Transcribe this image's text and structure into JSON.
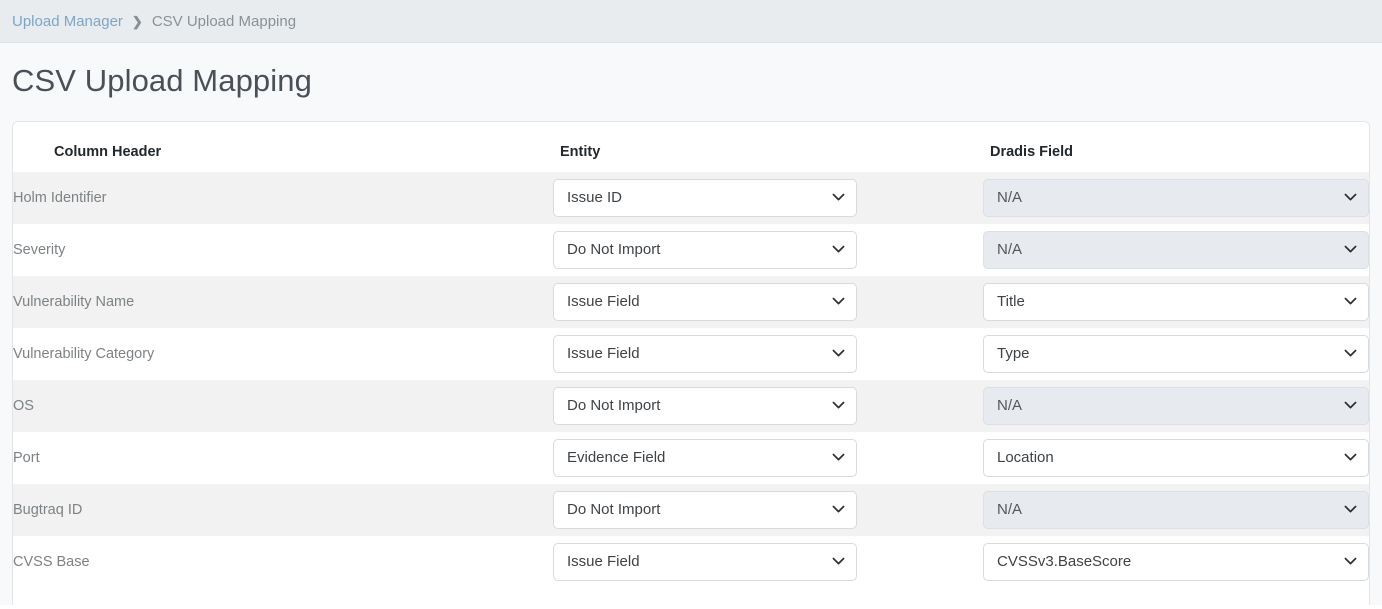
{
  "breadcrumb": {
    "parent_label": "Upload Manager",
    "separator": "›",
    "current_label": "CSV Upload Mapping"
  },
  "page": {
    "title": "CSV Upload Mapping"
  },
  "table": {
    "columns": {
      "column_header": "Column Header",
      "entity": "Entity",
      "dradis_field": "Dradis Field"
    },
    "rows": [
      {
        "column_header": "Holm Identifier",
        "entity": "Issue ID",
        "entity_disabled": false,
        "dradis_field": "N/A",
        "dradis_disabled": true
      },
      {
        "column_header": "Severity",
        "entity": "Do Not Import",
        "entity_disabled": false,
        "dradis_field": "N/A",
        "dradis_disabled": true
      },
      {
        "column_header": "Vulnerability Name",
        "entity": "Issue Field",
        "entity_disabled": false,
        "dradis_field": "Title",
        "dradis_disabled": false
      },
      {
        "column_header": "Vulnerability Category",
        "entity": "Issue Field",
        "entity_disabled": false,
        "dradis_field": "Type",
        "dradis_disabled": false
      },
      {
        "column_header": "OS",
        "entity": "Do Not Import",
        "entity_disabled": false,
        "dradis_field": "N/A",
        "dradis_disabled": true
      },
      {
        "column_header": "Port",
        "entity": "Evidence Field",
        "entity_disabled": false,
        "dradis_field": "Location",
        "dradis_disabled": false
      },
      {
        "column_header": "Bugtraq ID",
        "entity": "Do Not Import",
        "entity_disabled": false,
        "dradis_field": "N/A",
        "dradis_disabled": true
      },
      {
        "column_header": "CVSS Base",
        "entity": "Issue Field",
        "entity_disabled": false,
        "dradis_field": "CVSSv3.BaseScore",
        "dradis_disabled": false
      }
    ]
  },
  "colors": {
    "breadcrumb_bar": "#e9ecef",
    "breadcrumb_link": "#7aa7c7",
    "page_background": "#f8f9fa",
    "card_background": "#ffffff",
    "row_stripe": "#f2f2f2",
    "select_disabled": "#e7eaee"
  },
  "icons": {
    "breadcrumb_separator": "chevron-right-icon",
    "select_caret": "chevron-down-icon"
  }
}
